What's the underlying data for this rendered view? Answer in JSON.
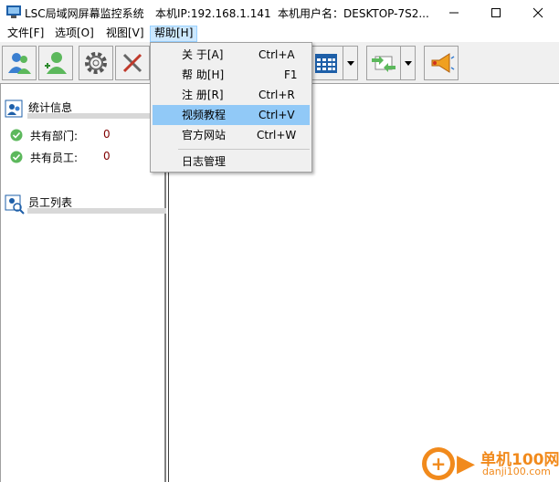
{
  "window": {
    "title": "LSC局域网屏幕监控系统",
    "ip_text": "本机IP:192.168.1.141",
    "user_text": "本机用户名：DESKTOP-7S2..."
  },
  "menubar": {
    "items": [
      "文件[F]",
      "选项[O]",
      "视图[V]",
      "帮助[H]"
    ]
  },
  "help_menu": {
    "items": [
      {
        "label": "关 于[A]",
        "shortcut": "Ctrl+A"
      },
      {
        "label": "帮 助[H]",
        "shortcut": "F1"
      },
      {
        "label": "注 册[R]",
        "shortcut": "Ctrl+R"
      },
      {
        "label": "视频教程",
        "shortcut": "Ctrl+V"
      },
      {
        "label": "官方网站",
        "shortcut": "Ctrl+W"
      },
      {
        "label": "日志管理",
        "shortcut": ""
      }
    ]
  },
  "left_pane": {
    "stats_title": "统计信息",
    "stats": [
      {
        "label": "共有部门:",
        "value": "0"
      },
      {
        "label": "共有员工:",
        "value": "0"
      }
    ],
    "staff_title": "员工列表"
  },
  "watermark": {
    "brand": "单机100网",
    "url": "danji100.com"
  },
  "colors": {
    "menu_highlight": "#91c9f7",
    "menu_active": "#cce8ff",
    "value_color": "#800000",
    "watermark": "#f18a1c"
  }
}
